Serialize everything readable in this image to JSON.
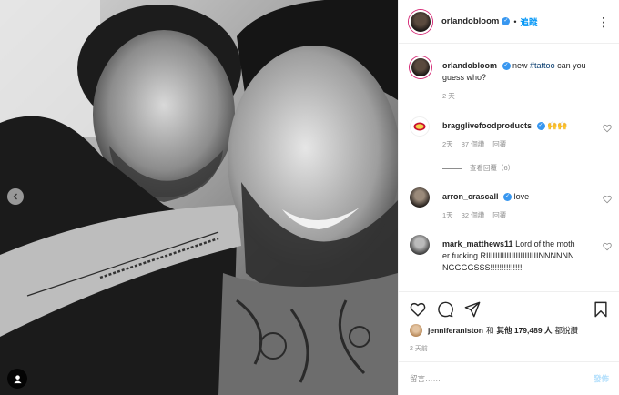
{
  "post": {
    "author": "orlandobloom",
    "follow_label": "追蹤",
    "more_icon": "more-icon",
    "caption_user": "orlandobloom",
    "caption_prefix": "new ",
    "caption_hashtag": "#tattoo",
    "caption_suffix": " can you guess who?",
    "caption_time": "2 天"
  },
  "comments": [
    {
      "user": "bragglivefoodproducts",
      "verified": true,
      "text": "🙌🙌",
      "time": "2天",
      "likes": "87 個讚",
      "reply": "回覆",
      "view_replies": "查看回覆（6）"
    },
    {
      "user": "arron_crascall",
      "verified": true,
      "text": "love",
      "time": "1天",
      "likes": "32 個讚",
      "reply": "回覆"
    },
    {
      "user": "mark_matthews11",
      "verified": false,
      "text": "Lord of the mother fucking RIIIIIIIIIIIIIIIIIIIIIIINNNNNNNGGGGSSS!!!!!!!!!!!!!!"
    }
  ],
  "likes_line": {
    "user": "jenniferaniston",
    "and": "和",
    "others_prefix": "其他",
    "count": "179,489",
    "others_suffix": "人",
    "liked": "都說讚"
  },
  "post_time": "2 天前",
  "comment_input": {
    "placeholder": "留言……",
    "post_label": "發佈"
  },
  "colors": {
    "link_blue": "#0095f6",
    "hashtag": "#00376b",
    "muted": "#8e8e8e",
    "verified": "#3897f0"
  }
}
